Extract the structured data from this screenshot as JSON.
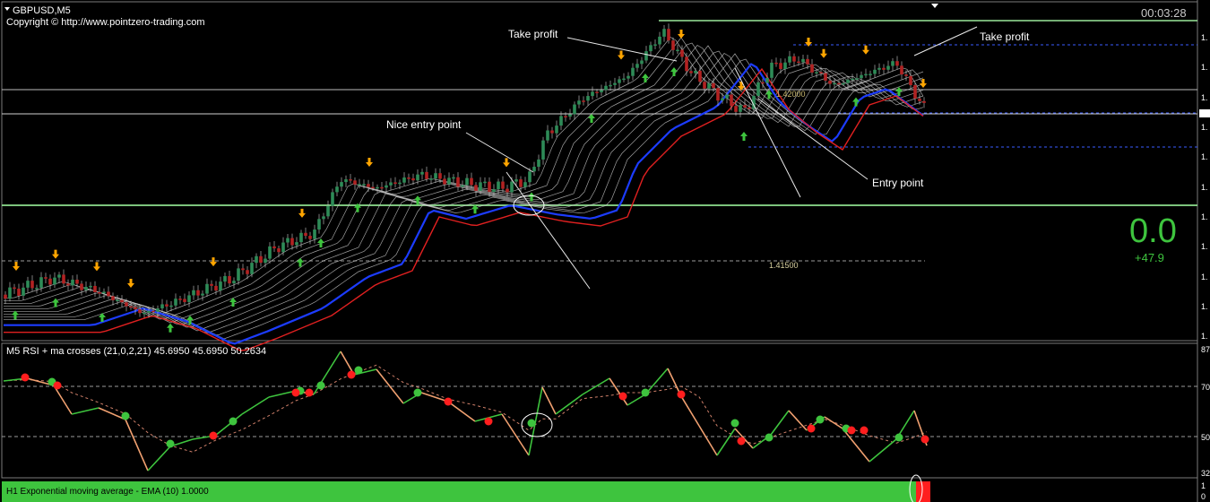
{
  "chart": {
    "symbol_label": "GBPUSD,M5",
    "copyright": "Copyright © http://www.pointzero-trading.com",
    "timer": "00:03:28",
    "profit_value": "0.0",
    "profit_pips": "+47.9",
    "level_label_low": "1.41500",
    "level_label_high": "1.42000",
    "price_axis_labels": [
      "1.",
      "1.",
      "1.",
      "1.",
      "1.",
      "1.",
      "1.",
      "1.",
      "1.",
      "1.",
      "1.",
      "1."
    ],
    "annotations": {
      "take_profit_1": "Take profit",
      "take_profit_2": "Take profit",
      "nice_entry": "Nice entry point",
      "entry": "Entry point"
    }
  },
  "rsi_panel": {
    "title": "M5 RSI + ma crosses (21,0,2,21) 45.6950 45.6950 50.2634",
    "axis_labels": [
      "87",
      "70",
      "50",
      "32"
    ]
  },
  "ema_panel": {
    "title": "H1 Exponential moving average - EMA (10) 1.0000",
    "axis_labels": [
      "1",
      "0"
    ]
  },
  "colors": {
    "bull_candle": "#2e8b57",
    "bear_candle": "#b22222",
    "lower_ema": "#e02020",
    "blue_ema": "#1c3cff",
    "ribbon": "#c8c8c8",
    "rsi_up": "#3ec43e",
    "rsi_down": "#f0a070",
    "ema_bar": "#3ec43e",
    "ema_bar_red": "#ff1e1e",
    "level_green": "#8fe08f",
    "level_blue": "#3a5cff",
    "arrow_up": "#3ec43e",
    "arrow_down": "#ffa500"
  }
}
